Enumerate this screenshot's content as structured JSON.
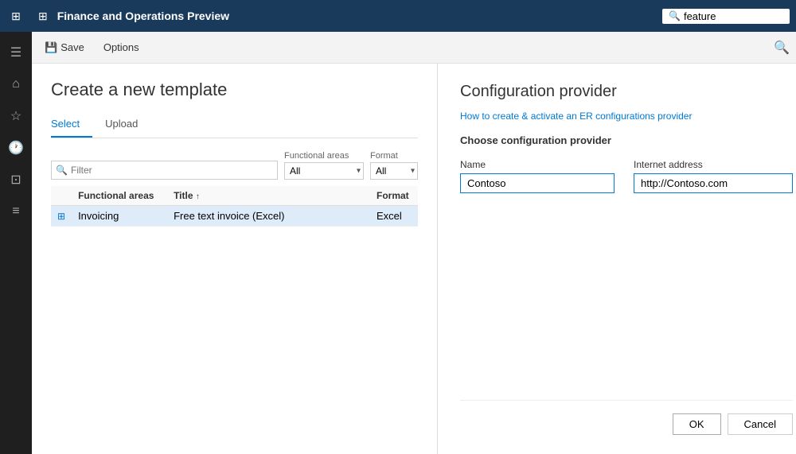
{
  "app": {
    "title": "Finance and Operations Preview",
    "search_placeholder": "feature"
  },
  "commandbar": {
    "save_label": "Save",
    "options_label": "Options"
  },
  "left_panel": {
    "page_title": "Create a new template",
    "tabs": [
      {
        "id": "select",
        "label": "Select",
        "active": true
      },
      {
        "id": "upload",
        "label": "Upload",
        "active": false
      }
    ],
    "filter": {
      "placeholder": "Filter"
    },
    "functional_areas_label": "Functional areas",
    "functional_areas_value": "All",
    "format_label": "Format",
    "format_value": "All",
    "table": {
      "columns": [
        {
          "id": "icon",
          "label": ""
        },
        {
          "id": "area",
          "label": "Functional areas"
        },
        {
          "id": "title",
          "label": "Title",
          "sorted": "asc"
        },
        {
          "id": "format",
          "label": "Format"
        }
      ],
      "rows": [
        {
          "selected": true,
          "icon": "⊞",
          "area": "Invoicing",
          "title": "Free text invoice (Excel)",
          "format": "Excel"
        }
      ]
    }
  },
  "right_panel": {
    "title": "Configuration provider",
    "link_text": "How to create & activate an ER configurations provider",
    "subtitle": "Choose configuration provider",
    "name_label": "Name",
    "name_value": "Contoso",
    "internet_address_label": "Internet address",
    "internet_address_value": "http://Contoso.com",
    "ok_label": "OK",
    "cancel_label": "Cancel"
  },
  "sidebar": {
    "icons": [
      {
        "id": "hamburger",
        "symbol": "☰"
      },
      {
        "id": "home",
        "symbol": "⌂"
      },
      {
        "id": "star",
        "symbol": "★"
      },
      {
        "id": "clock",
        "symbol": "⏱"
      },
      {
        "id": "grid",
        "symbol": "⊞"
      },
      {
        "id": "list",
        "symbol": "≡"
      }
    ]
  }
}
